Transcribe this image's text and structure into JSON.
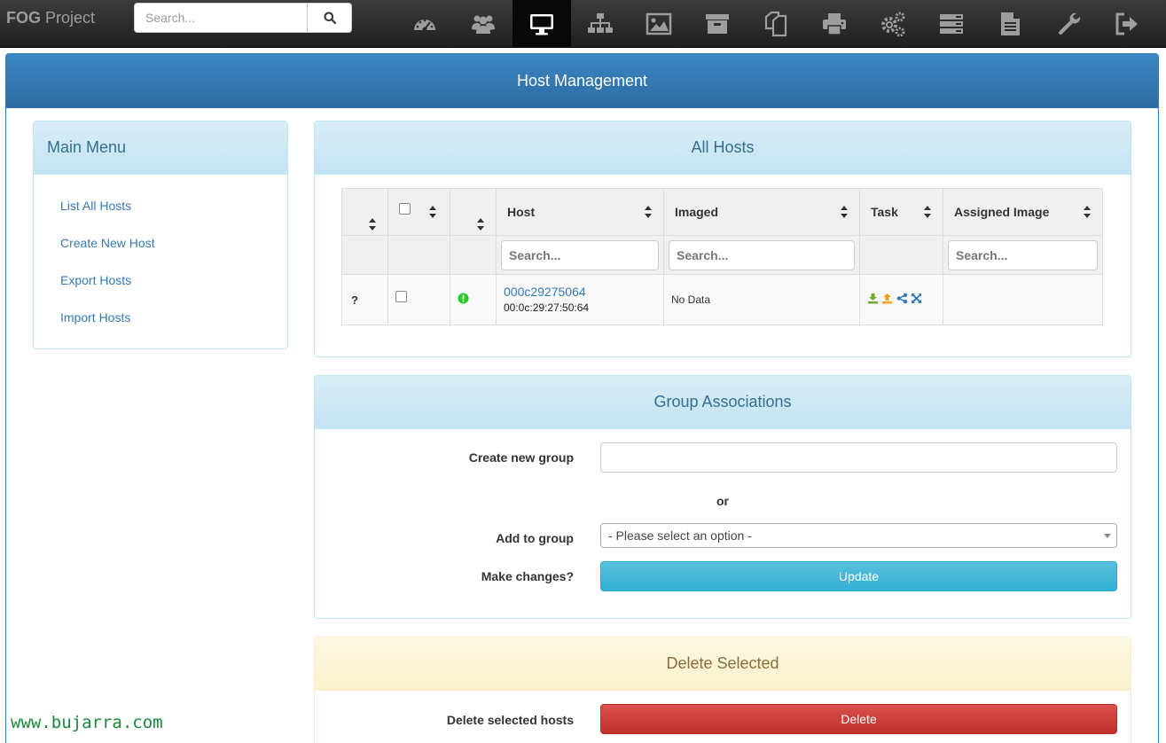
{
  "brand": {
    "bold": "FOG",
    "rest": "Project"
  },
  "navbar": {
    "search_placeholder": "Search...",
    "icons": [
      "dashboard-icon",
      "users-icon",
      "desktop-icon",
      "sitemap-icon",
      "image-icon",
      "archive-icon",
      "copy-icon",
      "print-icon",
      "cogs-icon",
      "server-icon",
      "file-icon",
      "wrench-icon",
      "sign-out-icon"
    ],
    "active_icon": "desktop-icon"
  },
  "page": {
    "title": "Host Management"
  },
  "main_menu": {
    "title": "Main Menu",
    "items": [
      "List All Hosts",
      "Create New Host",
      "Export Hosts",
      "Import Hosts"
    ]
  },
  "all_hosts": {
    "title": "All Hosts",
    "columns": [
      "",
      "",
      "",
      "Host",
      "Imaged",
      "Task",
      "Assigned Image"
    ],
    "search_placeholder": "Search...",
    "rows": [
      {
        "status": "?",
        "host": "000c29275064",
        "mac": "00:0c:29:27:50:64",
        "imaged": "No Data",
        "assigned_image": ""
      }
    ],
    "task_icons": [
      "deploy-icon",
      "capture-icon",
      "share-icon",
      "expand-icon"
    ]
  },
  "group_associations": {
    "title": "Group Associations",
    "create_label": "Create new group",
    "or_label": "or",
    "add_label": "Add to group",
    "select_value": "- Please select an option -",
    "changes_label": "Make changes?",
    "update_button": "Update"
  },
  "delete_selected": {
    "title": "Delete Selected",
    "label": "Delete selected hosts",
    "delete_button": "Delete"
  },
  "watermark": "www.bujarra.com",
  "colors": {
    "primary": "#337ab7",
    "info": "#5bc0de",
    "danger": "#d9534f",
    "warning_bg": "#fcf8e3",
    "info_bg": "#d9edf7"
  }
}
